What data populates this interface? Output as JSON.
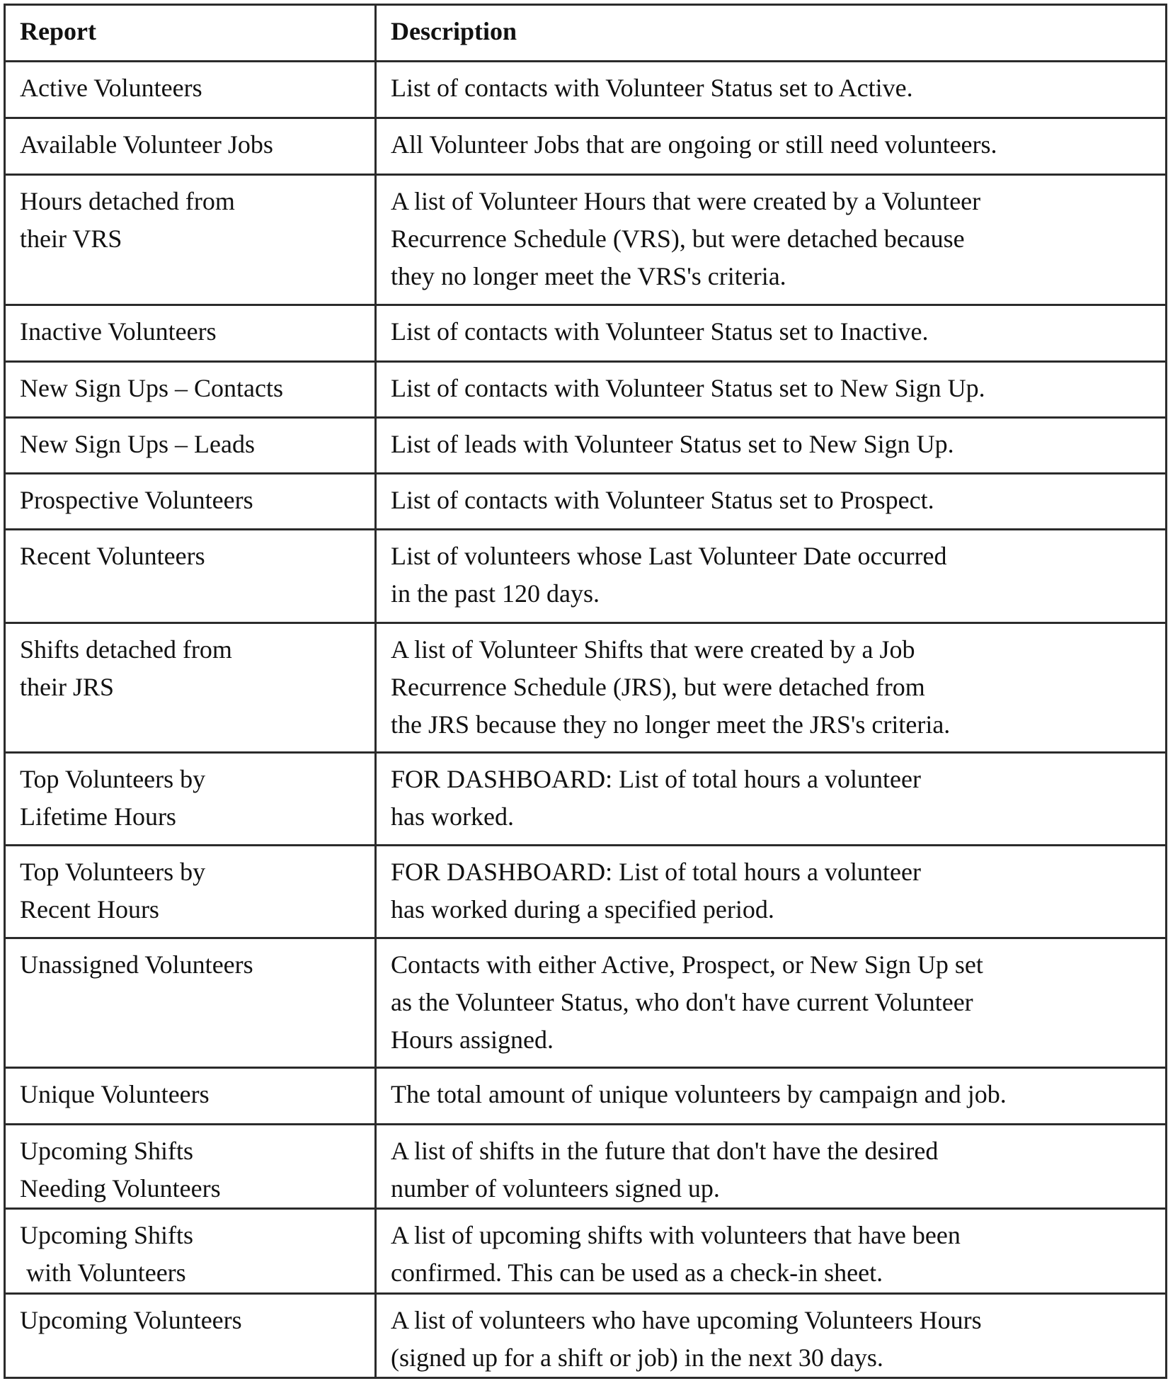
{
  "table": {
    "headers": [
      "Report",
      "Description"
    ],
    "rows": [
      {
        "report": [
          "Active Volunteers"
        ],
        "description": [
          "List of contacts with Volunteer Status set to Active."
        ]
      },
      {
        "report": [
          "Available Volunteer Jobs"
        ],
        "description": [
          "All Volunteer Jobs that are ongoing or still need volunteers."
        ]
      },
      {
        "report": [
          "Hours detached from",
          "their VRS"
        ],
        "description": [
          "A list of Volunteer Hours that were created by a Volunteer",
          "Recurrence Schedule (VRS), but were detached because",
          "they no longer meet the VRS's criteria."
        ]
      },
      {
        "report": [
          "Inactive Volunteers"
        ],
        "description": [
          "List of contacts with Volunteer Status set to Inactive."
        ]
      },
      {
        "report": [
          "New Sign Ups – Contacts"
        ],
        "description": [
          "List of contacts with Volunteer Status set to New Sign Up."
        ]
      },
      {
        "report": [
          "New Sign Ups – Leads"
        ],
        "description": [
          "List of leads with Volunteer Status set to New Sign Up."
        ]
      },
      {
        "report": [
          "Prospective Volunteers"
        ],
        "description": [
          "List of contacts with Volunteer Status set to Prospect."
        ]
      },
      {
        "report": [
          "Recent Volunteers"
        ],
        "description": [
          "List of volunteers whose Last Volunteer Date occurred",
          "in the past 120 days."
        ]
      },
      {
        "report": [
          "Shifts detached from",
          "their JRS"
        ],
        "description": [
          "A list of Volunteer Shifts that were created by a Job",
          "Recurrence Schedule (JRS), but were detached from",
          "the JRS because they no longer meet the JRS's criteria."
        ]
      },
      {
        "report": [
          "Top Volunteers by",
          "Lifetime Hours"
        ],
        "description": [
          "FOR DASHBOARD: List of total hours a volunteer",
          "has worked."
        ]
      },
      {
        "report": [
          "Top Volunteers by",
          "Recent Hours"
        ],
        "description": [
          "FOR DASHBOARD: List of total hours a volunteer",
          "has worked during a specified period."
        ]
      },
      {
        "report": [
          "Unassigned Volunteers"
        ],
        "description": [
          "Contacts with either Active, Prospect, or New Sign Up set",
          "as the Volunteer Status, who don't have current Volunteer",
          "Hours assigned."
        ]
      },
      {
        "report": [
          "Unique Volunteers"
        ],
        "description": [
          "The total amount of unique volunteers by campaign and job."
        ]
      },
      {
        "report": [
          "Upcoming Shifts",
          "Needing Volunteers"
        ],
        "description": [
          "A list of shifts in the future that don't have the desired",
          "number of volunteers signed up."
        ]
      },
      {
        "report": [
          "Upcoming Shifts",
          " with Volunteers"
        ],
        "description": [
          "A list of upcoming shifts with volunteers that have been",
          "confirmed. This can be used as a check-in sheet."
        ]
      },
      {
        "report": [
          "Upcoming Volunteers"
        ],
        "description": [
          "A list of volunteers who have upcoming Volunteers Hours",
          "(signed up for a shift or job) in the next 30 days."
        ]
      }
    ]
  }
}
